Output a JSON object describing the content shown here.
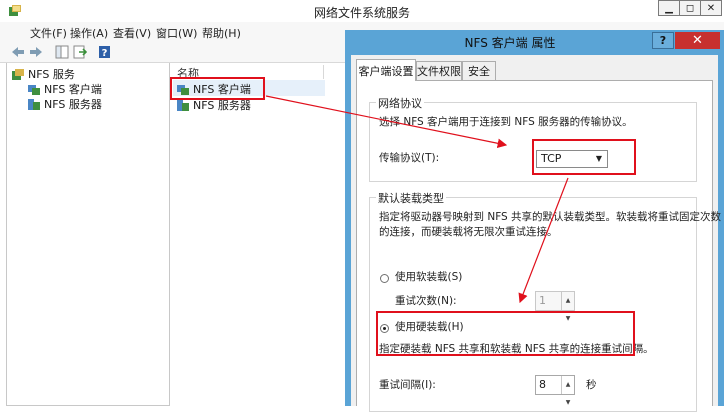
{
  "window": {
    "title": "网络文件系统服务",
    "controls": {
      "minimize": "▁",
      "restore": "◻",
      "close": "✕"
    }
  },
  "menu": {
    "items": [
      "文件(F)",
      "操作(A)",
      "查看(V)",
      "窗口(W)",
      "帮助(H)"
    ]
  },
  "toolbar": {
    "icons": [
      "back-arrow-icon",
      "forward-arrow-icon",
      "console-tree-icon",
      "export-list-icon",
      "help-book-icon"
    ]
  },
  "tree": {
    "root": "NFS 服务",
    "children": [
      "NFS 客户端",
      "NFS 服务器"
    ]
  },
  "list": {
    "column_header": "名称",
    "items": [
      "NFS 客户端",
      "NFS 服务器"
    ]
  },
  "dialog": {
    "title": "NFS 客户端 属性",
    "help_label": "?",
    "close_label": "✕",
    "tabs": [
      "客户端设置",
      "文件权限",
      "安全"
    ],
    "network_group": {
      "title": "网络协议",
      "description": "选择 NFS 客户端用于连接到 NFS 服务器的传输协议。",
      "protocol_label": "传输协议(T):",
      "protocol_value": "TCP"
    },
    "mount_group": {
      "title": "默认装载类型",
      "description_line1": "指定将驱动器号映射到 NFS 共享的默认装载类型。软装载将重试固定次数",
      "description_line2": "的连接，而硬装载将无限次重试连接。",
      "soft_label": "使用软装载(S)",
      "retry_label": "重试次数(N):",
      "retry_value": "1",
      "hard_label": "使用硬装载(H)",
      "hard_description": "指定硬装载 NFS 共享和软装载 NFS 共享的连接重试间隔。",
      "interval_label": "重试间隔(I):",
      "interval_value": "8",
      "interval_unit": "秒"
    }
  },
  "colors": {
    "dialog_frame": "#5aa4d6",
    "close_button": "#c7302f",
    "annotation_red": "#e0101c"
  }
}
